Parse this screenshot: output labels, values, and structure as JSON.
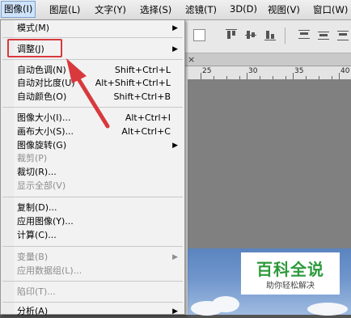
{
  "menubar": {
    "items": [
      "图像(I)",
      "图层(L)",
      "文字(Y)",
      "选择(S)",
      "滤镜(T)",
      "3D(D)",
      "视图(V)",
      "窗口(W)"
    ]
  },
  "image_menu": {
    "items": [
      {
        "label": "模式(M)",
        "shortcut": "",
        "submenu": true,
        "disabled": false
      },
      {
        "label": "调整(J)",
        "shortcut": "",
        "submenu": true,
        "disabled": false
      },
      {
        "label": "自动色调(N)",
        "shortcut": "Shift+Ctrl+L",
        "submenu": false,
        "disabled": false
      },
      {
        "label": "自动对比度(U)",
        "shortcut": "Alt+Shift+Ctrl+L",
        "submenu": false,
        "disabled": false
      },
      {
        "label": "自动颜色(O)",
        "shortcut": "Shift+Ctrl+B",
        "submenu": false,
        "disabled": false
      },
      {
        "label": "图像大小(I)...",
        "shortcut": "Alt+Ctrl+I",
        "submenu": false,
        "disabled": false
      },
      {
        "label": "画布大小(S)...",
        "shortcut": "Alt+Ctrl+C",
        "submenu": false,
        "disabled": false
      },
      {
        "label": "图像旋转(G)",
        "shortcut": "",
        "submenu": true,
        "disabled": false
      },
      {
        "label": "裁剪(P)",
        "shortcut": "",
        "submenu": false,
        "disabled": true
      },
      {
        "label": "裁切(R)...",
        "shortcut": "",
        "submenu": false,
        "disabled": false
      },
      {
        "label": "显示全部(V)",
        "shortcut": "",
        "submenu": false,
        "disabled": true
      },
      {
        "label": "复制(D)...",
        "shortcut": "",
        "submenu": false,
        "disabled": false
      },
      {
        "label": "应用图像(Y)...",
        "shortcut": "",
        "submenu": false,
        "disabled": false
      },
      {
        "label": "计算(C)...",
        "shortcut": "",
        "submenu": false,
        "disabled": false
      },
      {
        "label": "变量(B)",
        "shortcut": "",
        "submenu": true,
        "disabled": true
      },
      {
        "label": "应用数据组(L)...",
        "shortcut": "",
        "submenu": false,
        "disabled": true
      },
      {
        "label": "陷印(T)...",
        "shortcut": "",
        "submenu": false,
        "disabled": true
      },
      {
        "label": "分析(A)",
        "shortcut": "",
        "submenu": true,
        "disabled": false
      }
    ]
  },
  "ruler": {
    "labels": [
      "25",
      "30",
      "35",
      "40"
    ]
  },
  "watermark": {
    "title": "百科全说",
    "subtitle": "助你轻松解决"
  },
  "colors": {
    "highlight": "#d8393d",
    "menu_bg": "#f2f2f2",
    "canvas_gray": "#808080"
  }
}
